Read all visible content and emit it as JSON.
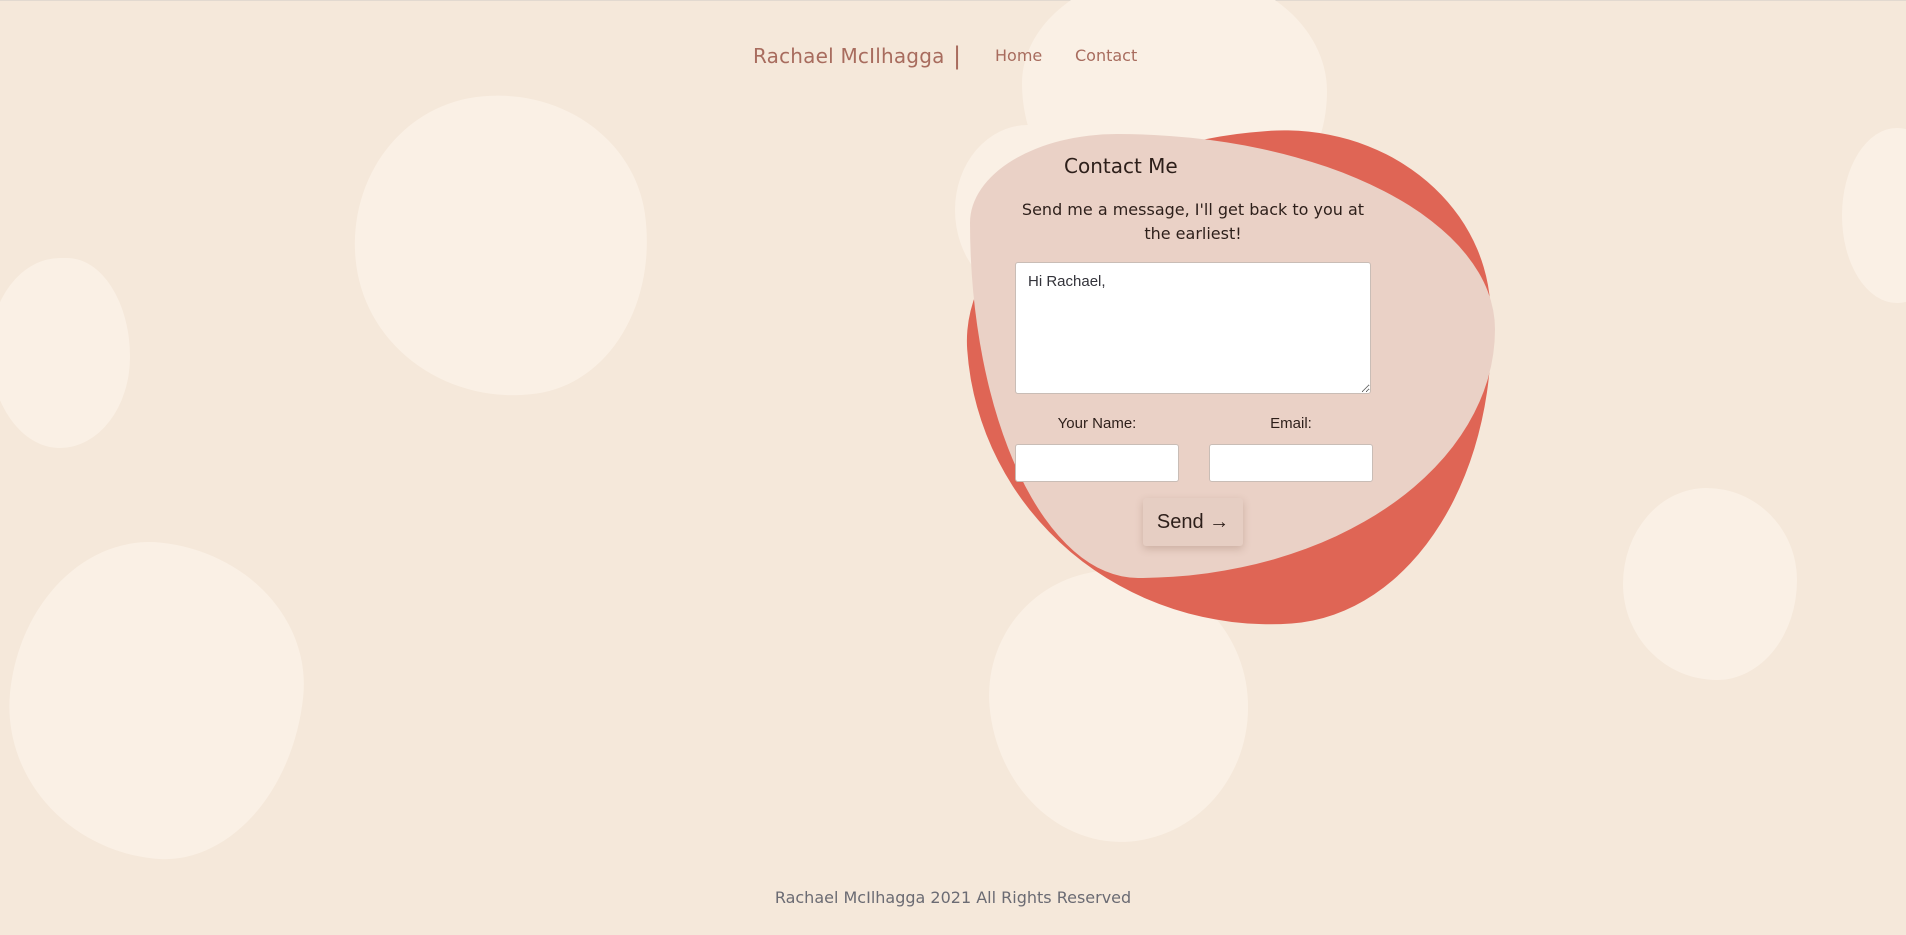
{
  "nav": {
    "brand": "Rachael McIlhagga",
    "separator": "|",
    "links": [
      {
        "label": "Home"
      },
      {
        "label": "Contact"
      }
    ]
  },
  "contact": {
    "title": "Contact Me",
    "subtitle": "Send me a message, I'll get back to you at the earliest!",
    "message_value": "Hi Rachael,",
    "name_label": "Your Name:",
    "name_value": "",
    "email_label": "Email:",
    "email_value": "",
    "send_label": "Send →"
  },
  "footer": {
    "text": "Rachael McIlhagga 2021 All Rights Reserved"
  },
  "colors": {
    "background": "#f5e8da",
    "blob": "#faf0e5",
    "accent": "#df6555",
    "card": "#ead1c6",
    "brand_text": "#a86c5e"
  }
}
